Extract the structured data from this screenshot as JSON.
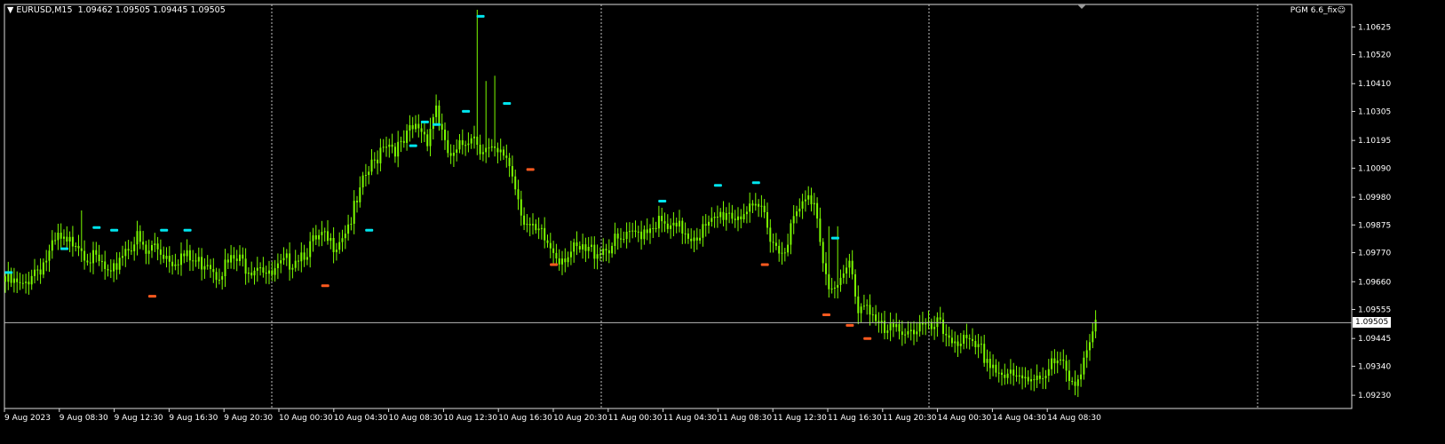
{
  "header": {
    "collapse_icon": "triangle-down-icon",
    "symbol": "EURUSD,M15",
    "ohlc": "1.09462 1.09505 1.09445 1.09505"
  },
  "indicator": {
    "label": "PGM 6.6_fix",
    "icon": "smiley-icon"
  },
  "colors": {
    "background": "#000000",
    "candle": "#7CFC00",
    "grid": "#C0C0C0",
    "high_marker": "#00E5EE",
    "low_marker": "#FF5A1F",
    "axis_text": "#FFFFFF"
  },
  "chart_data": {
    "type": "candlestick",
    "symbol": "EURUSD",
    "timeframe": "M15",
    "current_price": 1.09505,
    "ylim": [
      1.0918,
      1.1071
    ],
    "y_ticks": [
      1.10625,
      1.1052,
      1.1041,
      1.10305,
      1.10195,
      1.1009,
      1.0998,
      1.09875,
      1.0977,
      1.0966,
      1.09555,
      1.09445,
      1.0934,
      1.0923
    ],
    "y_tick_labels": [
      "1.10625",
      "1.10520",
      "1.10410",
      "1.10305",
      "1.10195",
      "1.10090",
      "1.09980",
      "1.09875",
      "1.09770",
      "1.09660",
      "1.09555",
      "1.09445",
      "1.09340",
      "1.09230"
    ],
    "x_labels": [
      "9 Aug 2023",
      "9 Aug 08:30",
      "9 Aug 12:30",
      "9 Aug 16:30",
      "9 Aug 20:30",
      "10 Aug 00:30",
      "10 Aug 04:30",
      "10 Aug 08:30",
      "10 Aug 12:30",
      "10 Aug 16:30",
      "10 Aug 20:30",
      "11 Aug 00:30",
      "11 Aug 04:30",
      "11 Aug 08:30",
      "11 Aug 12:30",
      "11 Aug 16:30",
      "11 Aug 20:30",
      "14 Aug 00:30",
      "14 Aug 04:30",
      "14 Aug 08:30"
    ],
    "day_separators": [
      "10 Aug 2023",
      "11 Aug 2023",
      "14 Aug 2023",
      "15 Aug 2023"
    ],
    "close_path": [
      [
        0,
        1.0968
      ],
      [
        3,
        1.0967
      ],
      [
        6,
        1.0965
      ],
      [
        9,
        1.0972
      ],
      [
        12,
        1.0974
      ],
      [
        15,
        1.0978
      ],
      [
        18,
        1.0984
      ],
      [
        21,
        1.0981
      ],
      [
        24,
        1.0985
      ],
      [
        27,
        1.098
      ],
      [
        30,
        1.0976
      ],
      [
        33,
        1.0974
      ],
      [
        36,
        1.0968
      ],
      [
        39,
        1.0978
      ],
      [
        42,
        1.0982
      ],
      [
        45,
        1.0984
      ],
      [
        48,
        1.0978
      ],
      [
        51,
        1.0982
      ],
      [
        54,
        1.0979
      ],
      [
        57,
        1.0977
      ],
      [
        60,
        1.0978
      ],
      [
        63,
        1.0976
      ],
      [
        66,
        1.0975
      ],
      [
        69,
        1.0977
      ],
      [
        72,
        1.0972
      ],
      [
        75,
        1.0974
      ],
      [
        78,
        1.0976
      ],
      [
        81,
        1.0975
      ],
      [
        84,
        1.0974
      ],
      [
        87,
        1.0976
      ],
      [
        90,
        1.0969
      ],
      [
        93,
        1.0972
      ],
      [
        96,
        1.0975
      ],
      [
        99,
        1.0978
      ],
      [
        102,
        1.098
      ],
      [
        105,
        1.0982
      ],
      [
        108,
        1.0984
      ],
      [
        111,
        1.0982
      ],
      [
        114,
        1.0985
      ],
      [
        117,
        1.099
      ],
      [
        120,
        1.0997
      ],
      [
        123,
        1.1008
      ],
      [
        126,
        1.1013
      ],
      [
        129,
        1.1022
      ],
      [
        132,
        1.102
      ],
      [
        135,
        1.1018
      ],
      [
        138,
        1.1024
      ],
      [
        141,
        1.1027
      ],
      [
        144,
        1.1023
      ],
      [
        147,
        1.1035
      ],
      [
        150,
        1.1018
      ],
      [
        153,
        1.1014
      ],
      [
        156,
        1.102
      ],
      [
        159,
        1.1025
      ],
      [
        162,
        1.102
      ],
      [
        165,
        1.1017
      ],
      [
        168,
        1.1015
      ],
      [
        171,
        1.1016
      ],
      [
        174,
        1.1005
      ],
      [
        177,
        1.0992
      ],
      [
        180,
        1.0986
      ],
      [
        183,
        1.0985
      ],
      [
        186,
        1.0981
      ],
      [
        189,
        1.0978
      ],
      [
        192,
        1.0979
      ],
      [
        195,
        1.0979
      ],
      [
        198,
        1.0979
      ],
      [
        201,
        1.098
      ],
      [
        204,
        1.0981
      ],
      [
        207,
        1.0982
      ],
      [
        210,
        1.0983
      ],
      [
        213,
        1.0984
      ],
      [
        216,
        1.0987
      ],
      [
        219,
        1.0989
      ],
      [
        222,
        1.0991
      ],
      [
        225,
        1.0988
      ],
      [
        228,
        1.0987
      ],
      [
        231,
        1.0988
      ],
      [
        234,
        1.0986
      ],
      [
        237,
        1.0987
      ],
      [
        240,
        1.0988
      ],
      [
        243,
        1.0992
      ],
      [
        246,
        1.0995
      ],
      [
        249,
        1.0993
      ],
      [
        252,
        1.0995
      ],
      [
        255,
        1.0993
      ],
      [
        258,
        1.0996
      ],
      [
        261,
        1.0987
      ],
      [
        264,
        1.0979
      ],
      [
        267,
        1.0985
      ],
      [
        270,
        1.0993
      ],
      [
        273,
        1.0998
      ],
      [
        276,
        1.1
      ],
      [
        279,
        1.0978
      ],
      [
        282,
        1.0964
      ],
      [
        285,
        1.0966
      ],
      [
        288,
        1.0975
      ],
      [
        291,
        1.0958
      ],
      [
        294,
        1.0961
      ],
      [
        297,
        1.0953
      ],
      [
        300,
        1.0948
      ],
      [
        303,
        1.0949
      ],
      [
        306,
        1.0951
      ],
      [
        309,
        1.095
      ],
      [
        312,
        1.0951
      ],
      [
        315,
        1.0949
      ],
      [
        318,
        1.0951
      ],
      [
        321,
        1.0948
      ],
      [
        324,
        1.0947
      ],
      [
        327,
        1.0945
      ],
      [
        330,
        1.0942
      ],
      [
        333,
        1.0941
      ],
      [
        336,
        1.0938
      ],
      [
        339,
        1.0934
      ],
      [
        342,
        1.0932
      ],
      [
        345,
        1.093
      ],
      [
        348,
        1.0931
      ],
      [
        351,
        1.0933
      ],
      [
        354,
        1.0934
      ],
      [
        357,
        1.0936
      ],
      [
        360,
        1.0937
      ],
      [
        363,
        1.093
      ],
      [
        366,
        1.0933
      ],
      [
        369,
        1.0943
      ],
      [
        372,
        1.095
      ]
    ],
    "spikes": [
      [
        26,
        1.0993
      ],
      [
        50,
        1.0975
      ],
      [
        161,
        1.1069
      ],
      [
        164,
        1.1042
      ],
      [
        167,
        1.1044
      ],
      [
        184,
        1.0989
      ],
      [
        281,
        1.0987
      ],
      [
        284,
        1.0987
      ]
    ],
    "high_markers": [
      [
        1,
        1.0969
      ],
      [
        20,
        1.0978
      ],
      [
        31,
        1.0986
      ],
      [
        37,
        1.0985
      ],
      [
        54,
        1.0985
      ],
      [
        62,
        1.0985
      ],
      [
        124,
        1.0985
      ],
      [
        139,
        1.1017
      ],
      [
        143,
        1.1026
      ],
      [
        147,
        1.1025
      ],
      [
        157,
        1.103
      ],
      [
        162,
        1.1066
      ],
      [
        171,
        1.1033
      ],
      [
        224,
        1.0996
      ],
      [
        243,
        1.1002
      ],
      [
        256,
        1.1003
      ],
      [
        283,
        1.0982
      ]
    ],
    "low_markers": [
      [
        50,
        1.0961
      ],
      [
        109,
        1.0965
      ],
      [
        179,
        1.1009
      ],
      [
        187,
        1.0973
      ],
      [
        259,
        1.0973
      ],
      [
        280,
        1.0954
      ],
      [
        288,
        1.095
      ],
      [
        294,
        1.0945
      ]
    ]
  }
}
